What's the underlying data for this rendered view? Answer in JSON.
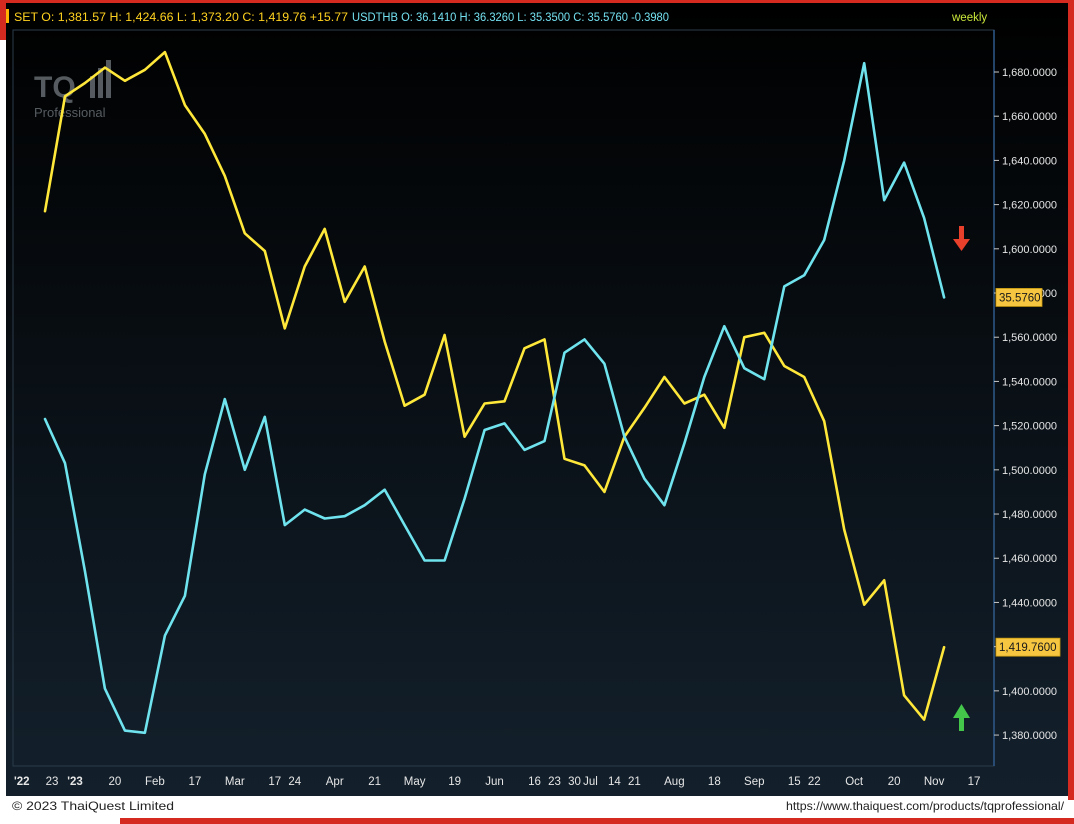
{
  "header": {
    "set_quote": "SET O: 1,381.57 H: 1,424.66 L: 1,373.20 C: 1,419.76 +15.77",
    "usd_quote": "USDTHB O: 36.1410 H: 36.3260 L: 35.3500 C: 35.5760 -0.3980",
    "period": "weekly"
  },
  "watermark": {
    "logo": "TQ",
    "sub": "Professional"
  },
  "footer": {
    "copyright": "© 2023 ThaiQuest Limited",
    "url": "https://www.thaiquest.com/products/tqprofessional/"
  },
  "colors": {
    "background_top": "#000000",
    "background_bottom": "#13202c",
    "set_line": "#ffe83a",
    "usd_line": "#6fe3ee",
    "border": "#d42a1f",
    "arrow_down": "#e8402b",
    "arrow_up": "#43c64a"
  },
  "icons": {
    "down": "arrow-down-icon",
    "up": "arrow-up-icon"
  },
  "chart_data": {
    "type": "line",
    "title": "",
    "ylabel": "",
    "xlabel": "",
    "ylim": [
      1366,
      1699
    ],
    "y_ticks": [
      "1,680.0000",
      "1,660.0000",
      "1,640.0000",
      "1,620.0000",
      "1,600.0000",
      "1,580.0000",
      "1,560.0000",
      "1,540.0000",
      "1,520.0000",
      "1,500.0000",
      "1,480.0000",
      "1,460.0000",
      "1,440.0000",
      "1,420.0000",
      "1,400.0000",
      "1,380.0000"
    ],
    "x_tick_labels": [
      "'22",
      "23",
      "'23",
      "20",
      "Feb",
      "17",
      "Mar",
      "17",
      "24",
      "Apr",
      "21",
      "May",
      "19",
      "Jun",
      "16",
      "23",
      "30",
      "Jul",
      "14",
      "21",
      "Aug",
      "18",
      "Sep",
      "15",
      "22",
      "Oct",
      "20",
      "Nov",
      "17"
    ],
    "x_tick_weeks": [
      0.0,
      0.35,
      1.5,
      3.5,
      5.5,
      7.5,
      9.5,
      11.5,
      12.5,
      14.5,
      16.5,
      18.5,
      20.5,
      22.5,
      24.5,
      25.5,
      26.5,
      27.3,
      28.5,
      29.5,
      31.5,
      33.5,
      35.5,
      37.5,
      38.5,
      40.5,
      42.5,
      44.5,
      46.5
    ],
    "series": [
      {
        "values": [
          1617,
          1669,
          1675,
          1682,
          1676,
          1681,
          1689,
          1665,
          1652,
          1633,
          1607,
          1599,
          1564,
          1592,
          1609,
          1576,
          1592,
          1558,
          1529,
          1534,
          1561,
          1515,
          1530,
          1531,
          1555,
          1559,
          1505,
          1502,
          1490,
          1515,
          1528,
          1542,
          1530,
          1534,
          1519,
          1560,
          1562,
          1547,
          1542,
          1522,
          1473,
          1439,
          1450,
          1398,
          1387,
          1419.76
        ]
      },
      {
        "values": [
          1523,
          1503,
          1454,
          1401,
          1382,
          1381,
          1425,
          1443,
          1498,
          1532,
          1500,
          1524,
          1475,
          1482,
          1478,
          1479,
          1484,
          1491,
          1475,
          1459,
          1459,
          1487,
          1518,
          1521,
          1509,
          1513,
          1553,
          1559,
          1548,
          1515,
          1496,
          1484,
          1512,
          1542,
          1565,
          1546,
          1541,
          1583,
          1588,
          1604,
          1640,
          1684,
          1622,
          1639,
          1614,
          1578
        ]
      }
    ],
    "price_tags": [
      "35.5760",
      "1,419.7600"
    ]
  }
}
